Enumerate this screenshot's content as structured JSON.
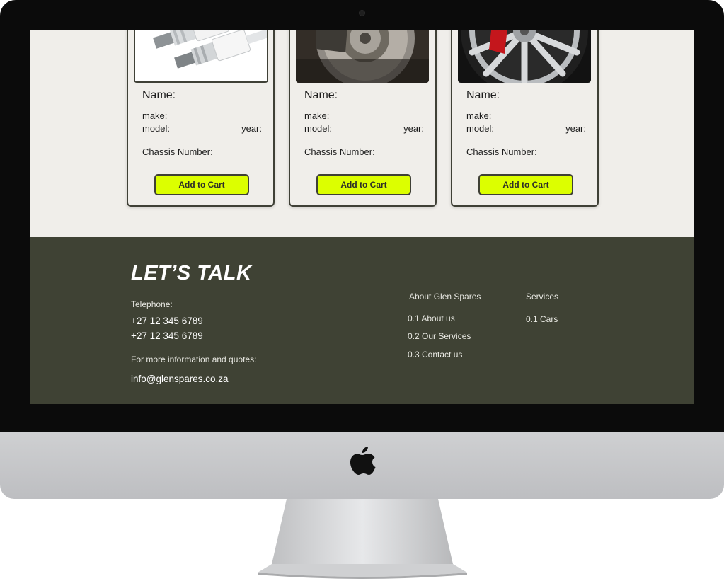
{
  "products": [
    {
      "image": "spark-plugs-image",
      "name_label": "Name:",
      "make_label": "make:",
      "model_label": "model:",
      "year_label": "year:",
      "chassis_label": "Chassis Number:",
      "button_label": "Add to Cart"
    },
    {
      "image": "brake-disc-image",
      "name_label": "Name:",
      "make_label": "make:",
      "model_label": "model:",
      "year_label": "year:",
      "chassis_label": "Chassis Number:",
      "button_label": "Add to Cart"
    },
    {
      "image": "alloy-wheel-image",
      "name_label": "Name:",
      "make_label": "make:",
      "model_label": "model:",
      "year_label": "year:",
      "chassis_label": "Chassis Number:",
      "button_label": "Add to Cart"
    }
  ],
  "footer": {
    "heading": "LET’S TALK",
    "telephone_label": "Telephone:",
    "phones": [
      "+27 12 345 6789",
      "+27 12 345 6789"
    ],
    "info_label": "For more information and quotes:",
    "email": "info@glenspares.co.za",
    "about": {
      "heading": "About Glen Spares",
      "links": [
        "0.1 About us",
        "0.2 Our Services",
        "0.3 Contact us"
      ]
    },
    "services": {
      "heading": "Services",
      "links": [
        "0.1 Cars"
      ]
    }
  },
  "colors": {
    "accent": "#dcff00",
    "footer_bg": "#3f4234",
    "page_bg": "#f0eeea",
    "border": "#3f4036"
  },
  "device": {
    "logo": "apple-logo-icon"
  }
}
